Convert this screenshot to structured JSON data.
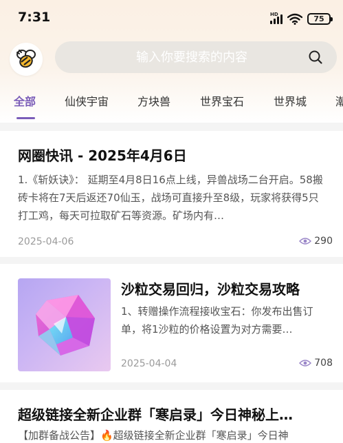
{
  "status_bar": {
    "time": "7:31",
    "network_label": "HD",
    "battery": "75"
  },
  "header": {
    "logo_icon": "bee-icon",
    "search": {
      "placeholder": "输入你要搜索的内容",
      "icon": "search-icon"
    }
  },
  "tabs": [
    {
      "label": "全部",
      "active": true
    },
    {
      "label": "仙侠宇宙",
      "active": false
    },
    {
      "label": "方块兽",
      "active": false
    },
    {
      "label": "世界宝石",
      "active": false
    },
    {
      "label": "世界城",
      "active": false
    },
    {
      "label": "潮",
      "active": false
    }
  ],
  "articles": [
    {
      "title": "网圈快讯 - 2025年4月6日",
      "summary": "1.《斩妖诀》： 延期至4月8日16点上线，异兽战场二台开启。58搬砖卡将在7天后返还70仙玉，战场可直接升至8级，玩家将获得5只打工鸡，每天可拉取矿石等资源。矿场内有…",
      "date": "2025-04-06",
      "views": "290"
    },
    {
      "title": "沙粒交易回归，沙粒交易攻略",
      "summary": "1、转赠操作流程接收宝石：你发布出售订单，将1沙粒的价格设置为对方需要…",
      "date": "2025-04-04",
      "views": "708",
      "thumbnail": "gem-crystal-image"
    },
    {
      "title": "超级链接全新企业群「寒启录」今日神秘上…",
      "summary": "【加群备战公告】🔥超级链接全新企业群「寒启录」今日神"
    }
  ],
  "colors": {
    "accent": "#7a5cb8",
    "header_bg": "#fbf0e4",
    "search_bg": "#e9e6e1"
  }
}
